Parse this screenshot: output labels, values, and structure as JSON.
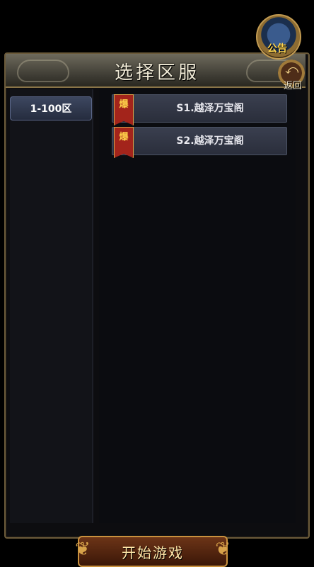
{
  "header": {
    "title": "选择区服",
    "back_label": "返回",
    "notice_label": "公告"
  },
  "zones": [
    {
      "label": "1-100区",
      "selected": true
    }
  ],
  "servers": [
    {
      "badge": "爆",
      "name": "S1.越泽万宝阁"
    },
    {
      "badge": "爆",
      "name": "S2.越泽万宝阁"
    }
  ],
  "footer": {
    "start_label": "开始游戏"
  },
  "colors": {
    "badge": "#a3241b",
    "gold": "#c9913e",
    "panel": "#0d0d10"
  }
}
